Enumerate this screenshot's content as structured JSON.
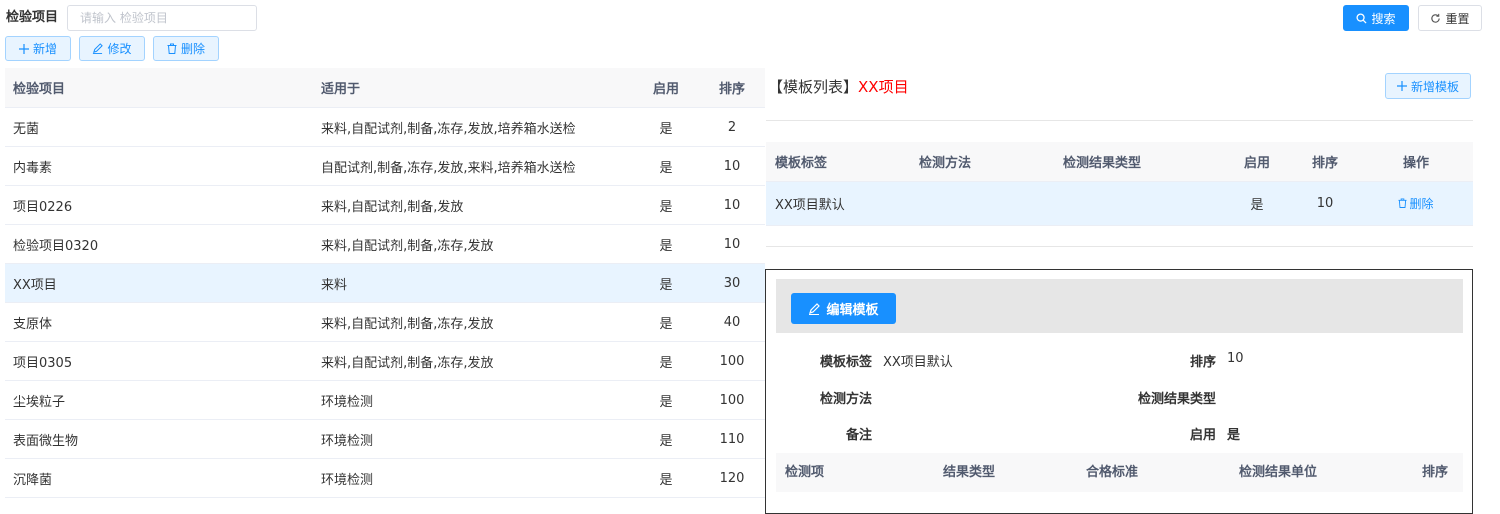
{
  "search": {
    "label": "检验项目",
    "placeholder": "请输入 检验项目",
    "value": "",
    "search_btn": "搜索",
    "reset_btn": "重置"
  },
  "toolbar": {
    "add": "新增",
    "edit": "修改",
    "delete": "删除"
  },
  "left_table": {
    "headers": [
      "检验项目",
      "适用于",
      "启用",
      "排序"
    ],
    "rows": [
      {
        "name": "无菌",
        "applies": "来料,自配试剂,制备,冻存,发放,培养箱水送检",
        "enabled": "是",
        "order": "2"
      },
      {
        "name": "内毒素",
        "applies": "自配试剂,制备,冻存,发放,来料,培养箱水送检",
        "enabled": "是",
        "order": "10"
      },
      {
        "name": "项目0226",
        "applies": "来料,自配试剂,制备,发放",
        "enabled": "是",
        "order": "10"
      },
      {
        "name": "检验项目0320",
        "applies": "来料,自配试剂,制备,冻存,发放",
        "enabled": "是",
        "order": "10"
      },
      {
        "name": "XX项目",
        "applies": "来料",
        "enabled": "是",
        "order": "30"
      },
      {
        "name": "支原体",
        "applies": "来料,自配试剂,制备,冻存,发放",
        "enabled": "是",
        "order": "40"
      },
      {
        "name": "项目0305",
        "applies": "来料,自配试剂,制备,冻存,发放",
        "enabled": "是",
        "order": "100"
      },
      {
        "name": "尘埃粒子",
        "applies": "环境检测",
        "enabled": "是",
        "order": "100"
      },
      {
        "name": "表面微生物",
        "applies": "环境检测",
        "enabled": "是",
        "order": "110"
      },
      {
        "name": "沉降菌",
        "applies": "环境检测",
        "enabled": "是",
        "order": "120"
      }
    ]
  },
  "template": {
    "title_prefix": "【模板列表】",
    "title_item": "XX项目",
    "add_btn": "新增模板",
    "headers": [
      "模板标签",
      "检测方法",
      "检测结果类型",
      "启用",
      "排序",
      "操作"
    ],
    "rows": [
      {
        "label": "XX项目默认",
        "method": "",
        "result_type": "",
        "enabled": "是",
        "order": "10",
        "action": "删除"
      }
    ]
  },
  "detail": {
    "edit_btn": "编辑模板",
    "fields": {
      "label_key": "模板标签",
      "label_val": "XX项目默认",
      "order_key": "排序",
      "order_val": "10",
      "method_key": "检测方法",
      "method_val": "",
      "result_type_key": "检测结果类型",
      "result_type_val": "",
      "remark_key": "备注",
      "remark_val": "",
      "enabled_key": "启用",
      "enabled_val": "是"
    },
    "sub_headers": [
      "检测项",
      "结果类型",
      "合格标准",
      "检测结果单位",
      "排序"
    ]
  },
  "colors": {
    "primary": "#1890ff",
    "highlight_row": "#e8f4ff",
    "title_red": "#ff0000"
  }
}
